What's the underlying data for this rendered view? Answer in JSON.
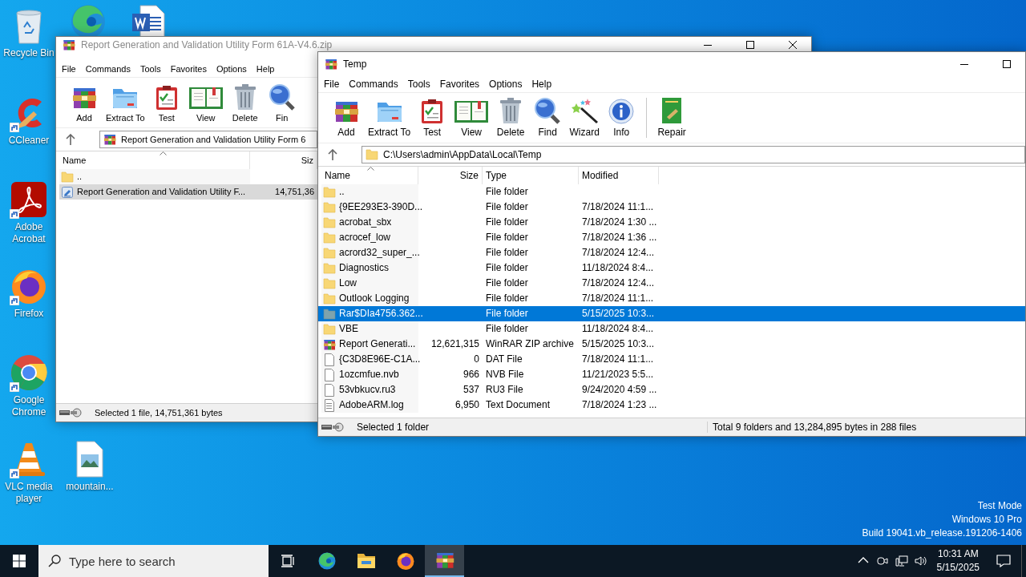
{
  "desktop_icons": [
    {
      "label": "Recycle Bin",
      "shortcut": false
    },
    {
      "shortcut": false
    },
    {
      "shortcut": false
    },
    {
      "label": "CCleaner",
      "shortcut": true
    },
    {
      "label": "Adobe Acrobat",
      "shortcut": true
    },
    {
      "label": "Firefox",
      "shortcut": true
    },
    {
      "label": "Google Chrome",
      "shortcut": true
    },
    {
      "label": "VLC media player",
      "shortcut": true
    },
    {
      "label": "mountain...",
      "shortcut": false
    }
  ],
  "windows": [
    {
      "title": "Report Generation and Validation Utility Form 61A-V4.6.zip",
      "active": false,
      "menu": [
        "File",
        "Commands",
        "Tools",
        "Favorites",
        "Options",
        "Help"
      ],
      "toolbar": [
        "Add",
        "Extract To",
        "Test",
        "View",
        "Delete",
        "Fin"
      ],
      "address": {
        "text": "Report Generation and Validation Utility Form 6",
        "kind": "archive"
      },
      "columns": [
        "Name",
        "Siz"
      ],
      "rows": [
        {
          "name": "..",
          "kind": "folder",
          "selected": false
        },
        {
          "name": "Report Generation and Validation Utility F...",
          "size": "14,751,36",
          "kind": "setup",
          "selected": true
        }
      ],
      "status": [
        "Selected 1 file, 14,751,361 bytes"
      ]
    },
    {
      "title": "Temp",
      "active": true,
      "menu": [
        "File",
        "Commands",
        "Tools",
        "Favorites",
        "Options",
        "Help"
      ],
      "toolbar": [
        "Add",
        "Extract To",
        "Test",
        "View",
        "Delete",
        "Find",
        "Wizard",
        "Info",
        "Repair"
      ],
      "address": {
        "text": "C:\\Users\\admin\\AppData\\Local\\Temp",
        "kind": "folder"
      },
      "columns": [
        "Name",
        "Size",
        "Type",
        "Modified"
      ],
      "rows": [
        {
          "name": "..",
          "type": "File folder",
          "kind": "folder",
          "selected": false
        },
        {
          "name": "{9EE293E3-390D...",
          "type": "File folder",
          "modified": "7/18/2024 11:1...",
          "kind": "folder",
          "selected": false
        },
        {
          "name": "acrobat_sbx",
          "type": "File folder",
          "modified": "7/18/2024 1:30 ...",
          "kind": "folder",
          "selected": false
        },
        {
          "name": "acrocef_low",
          "type": "File folder",
          "modified": "7/18/2024 1:36 ...",
          "kind": "folder",
          "selected": false
        },
        {
          "name": "acrord32_super_...",
          "type": "File folder",
          "modified": "7/18/2024 12:4...",
          "kind": "folder",
          "selected": false
        },
        {
          "name": "Diagnostics",
          "type": "File folder",
          "modified": "11/18/2024 8:4...",
          "kind": "folder",
          "selected": false
        },
        {
          "name": "Low",
          "type": "File folder",
          "modified": "7/18/2024 12:4...",
          "kind": "folder",
          "selected": false
        },
        {
          "name": "Outlook Logging",
          "type": "File folder",
          "modified": "7/18/2024 11:1...",
          "kind": "folder",
          "selected": false
        },
        {
          "name": "Rar$DIa4756.362...",
          "type": "File folder",
          "modified": "5/15/2025 10:3...",
          "kind": "folder",
          "selected": true
        },
        {
          "name": "VBE",
          "type": "File folder",
          "modified": "11/18/2024 8:4...",
          "kind": "folder",
          "selected": false
        },
        {
          "name": "Report Generati...",
          "size": "12,621,315",
          "type": "WinRAR ZIP archive",
          "modified": "5/15/2025 10:3...",
          "kind": "archive",
          "selected": false
        },
        {
          "name": "{C3D8E96E-C1A...",
          "size": "0",
          "type": "DAT File",
          "modified": "7/18/2024 11:1...",
          "kind": "file",
          "selected": false
        },
        {
          "name": "1ozcmfue.nvb",
          "size": "966",
          "type": "NVB File",
          "modified": "11/21/2023 5:5...",
          "kind": "file",
          "selected": false
        },
        {
          "name": "53vbkucv.ru3",
          "size": "537",
          "type": "RU3 File",
          "modified": "9/24/2020 4:59 ...",
          "kind": "file",
          "selected": false
        },
        {
          "name": "AdobeARM.log",
          "size": "6,950",
          "type": "Text Document",
          "modified": "7/18/2024 1:23 ...",
          "kind": "document",
          "selected": false
        }
      ],
      "status": [
        "Selected 1 folder",
        "Total 9 folders and 13,284,895 bytes in 288 files"
      ]
    }
  ],
  "os_watermark": [
    "Test Mode",
    "Windows 10 Pro",
    "Build 19041.vb_release.191206-1406"
  ],
  "taskbar": {
    "search_placeholder": "Type here to search",
    "apps": [
      {
        "active": false
      },
      {
        "active": false
      },
      {
        "active": false
      },
      {
        "active": true
      }
    ],
    "time": "10:31 AM",
    "date": "5/15/2025"
  }
}
